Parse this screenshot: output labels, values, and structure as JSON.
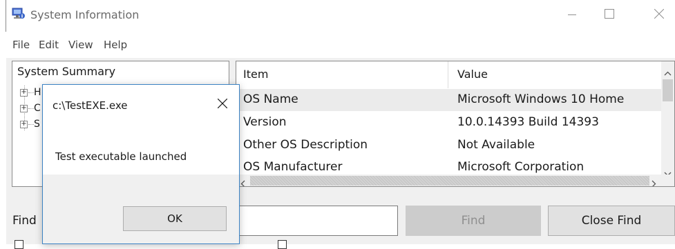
{
  "window": {
    "title": "System Information",
    "icon": "system-info-icon",
    "controls": [
      "minimize-icon",
      "maximize-icon",
      "close-icon"
    ]
  },
  "menu": [
    "File",
    "Edit",
    "View",
    "Help"
  ],
  "left_pane": {
    "title": "System Summary",
    "tree": [
      {
        "label": "H",
        "icon": "expand-plus-icon"
      },
      {
        "label": "C",
        "icon": "expand-plus-icon"
      },
      {
        "label": "S",
        "icon": "expand-plus-icon"
      }
    ]
  },
  "table": {
    "columns": [
      "Item",
      "Value"
    ],
    "rows": [
      {
        "item": "OS Name",
        "value": "Microsoft Windows 10 Home",
        "selected": true
      },
      {
        "item": "Version",
        "value": "10.0.14393 Build 14393",
        "selected": false
      },
      {
        "item": "Other OS Description",
        "value": "Not Available",
        "selected": false
      },
      {
        "item": "OS Manufacturer",
        "value": "Microsoft Corporation",
        "selected": false
      }
    ]
  },
  "find_bar": {
    "label": "Find",
    "input_value": "",
    "find_button": "Find",
    "find_button_enabled": false,
    "close_find_button": "Close Find"
  },
  "dialog": {
    "title": "c:\\TestEXE.exe",
    "message": "Test executable launched",
    "ok_button": "OK"
  },
  "colors": {
    "dialog_border": "#3c83c4",
    "panel_background": "#f0f0f0",
    "selected_row": "#ebebeb",
    "disabled_button": "#cccccc"
  }
}
